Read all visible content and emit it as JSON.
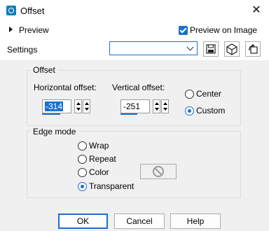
{
  "window": {
    "title": "Offset",
    "close_glyph": "✕"
  },
  "top": {
    "preview_label": "Preview",
    "preview_on_image_label": "Preview on Image",
    "preview_on_image_checked": true,
    "settings_label": "Settings",
    "preset_value": ""
  },
  "offset": {
    "group_label": "Offset",
    "horizontal_label": "Horizontal offset:",
    "horizontal_value": "-314",
    "vertical_label": "Vertical offset:",
    "vertical_value": "-251",
    "center_label": "Center",
    "custom_label": "Custom",
    "selected": "Custom"
  },
  "edge": {
    "group_label": "Edge mode",
    "options": [
      "Wrap",
      "Repeat",
      "Color",
      "Transparent"
    ],
    "selected": "Transparent"
  },
  "buttons": {
    "ok": "OK",
    "cancel": "Cancel",
    "help": "Help"
  },
  "icons": [
    "dialog-icon",
    "close-icon",
    "expand-chevron-icon",
    "save-preset-icon",
    "load-preset-icon",
    "reset-icon",
    "no-color-icon"
  ]
}
